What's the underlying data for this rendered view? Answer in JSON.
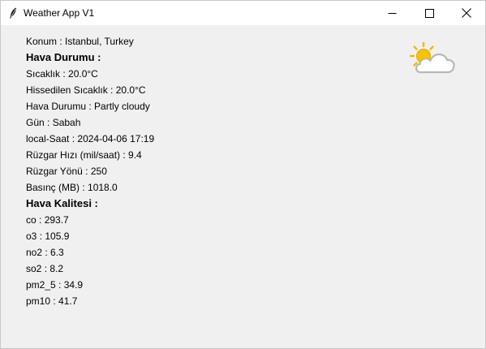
{
  "window": {
    "title": "Weather App V1"
  },
  "icons": {
    "app": "feather-icon",
    "weather": "partly-cloudy-icon"
  },
  "colors": {
    "sun": "#f5b800",
    "cloud_fill": "#ffffff",
    "cloud_stroke": "#b8b8b8"
  },
  "location": {
    "label": "Konum",
    "value": "Istanbul, Turkey"
  },
  "weather": {
    "heading": "Hava Durumu :",
    "items": [
      {
        "label": "Sıcaklık",
        "value": "20.0°C"
      },
      {
        "label": "Hissedilen Sıcaklık",
        "value": "20.0°C"
      },
      {
        "label": "Hava Durumu",
        "value": "Partly cloudy"
      },
      {
        "label": "Gün",
        "value": "Sabah"
      },
      {
        "label": "local-Saat",
        "value": "2024-04-06 17:19"
      },
      {
        "label": "Rüzgar Hızı (mil/saat)",
        "value": "9.4"
      },
      {
        "label": "Rüzgar Yönü",
        "value": "250"
      },
      {
        "label": "Basınç (MB)",
        "value": "1018.0"
      }
    ]
  },
  "air_quality": {
    "heading": "Hava Kalitesi :",
    "items": [
      {
        "label": "co",
        "value": "293.7"
      },
      {
        "label": "o3",
        "value": "105.9"
      },
      {
        "label": "no2",
        "value": "6.3"
      },
      {
        "label": "so2",
        "value": "8.2"
      },
      {
        "label": "pm2_5",
        "value": "34.9"
      },
      {
        "label": "pm10",
        "value": "41.7"
      }
    ]
  }
}
